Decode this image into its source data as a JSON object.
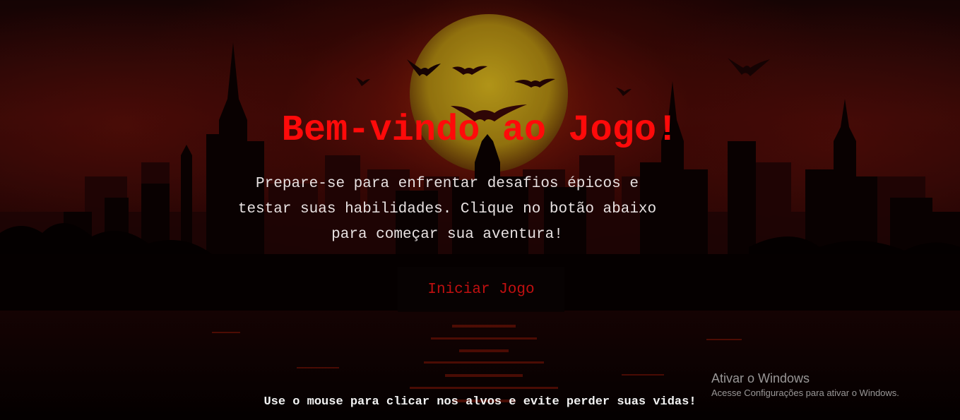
{
  "game": {
    "title": "Bem-vindo ao Jogo!",
    "intro": "Prepare-se para enfrentar desafios épicos e testar suas habilidades. Clique no botão abaixo para começar sua aventura!",
    "start_button_label": "Iniciar Jogo",
    "hint": "Use o mouse para clicar nos alvos e evite perder suas vidas!"
  },
  "windows_watermark": {
    "title": "Ativar o Windows",
    "subtitle": "Acesse Configurações para ativar o Windows."
  },
  "colors": {
    "title": "#ff0a0a",
    "button_text": "#c01010",
    "moon": "#c9a81a",
    "sky": "#3c0a08"
  },
  "background": {
    "icons": [
      "moon-icon",
      "bat-icon",
      "city-skyline"
    ]
  }
}
